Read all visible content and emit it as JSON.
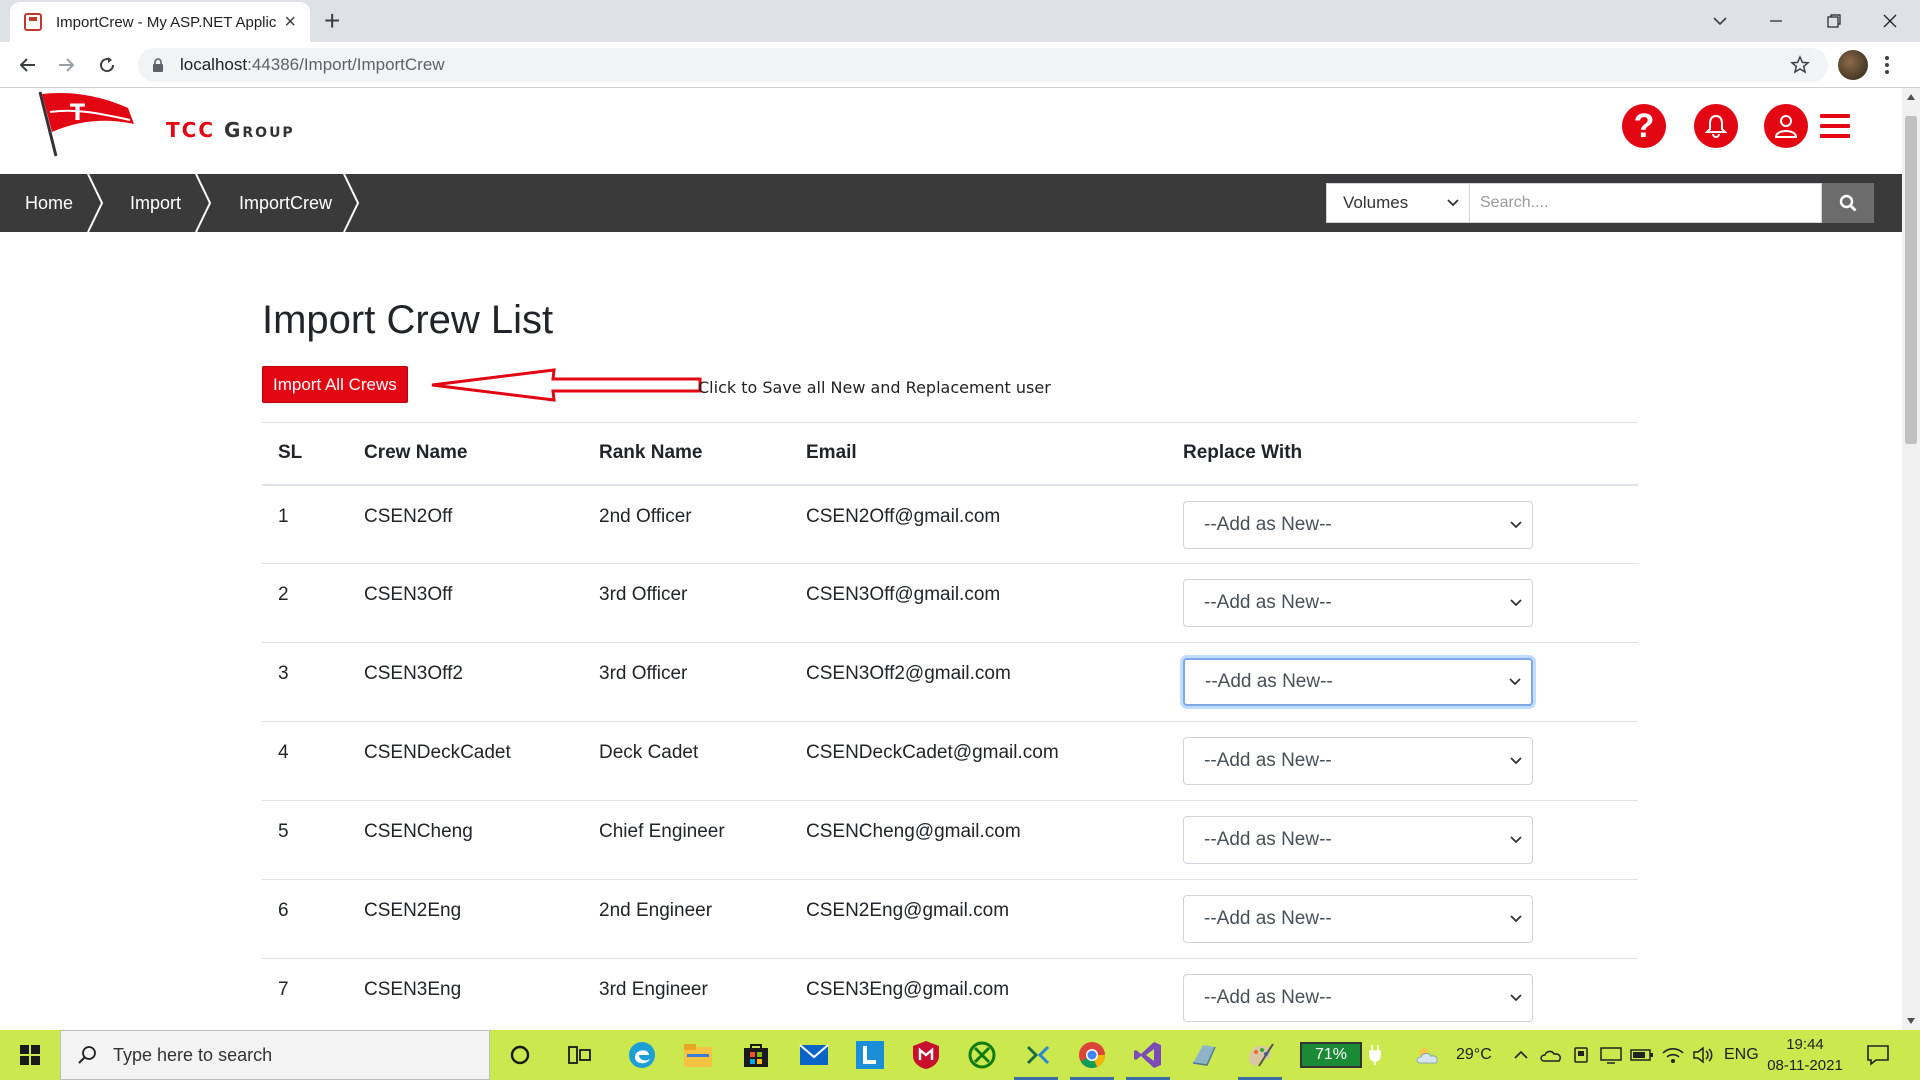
{
  "browser": {
    "tab_title": "ImportCrew - My ASP.NET Applic",
    "url_host": "localhost",
    "url_rest": ":44386/Import/ImportCrew"
  },
  "header": {
    "logo_tcc": "TCC",
    "logo_group": "Group",
    "logo_flag_letter": "T",
    "help_icon": "question-icon",
    "notif_icon": "bell-icon",
    "user_icon": "user-icon",
    "menu_icon": "hamburger-icon",
    "accent": "#e30613"
  },
  "breadcrumb": [
    "Home",
    "Import",
    "ImportCrew"
  ],
  "search": {
    "volume_selected": "Volumes",
    "placeholder": "Search...."
  },
  "main": {
    "title": "Import Crew List",
    "import_button": "Import All Crews",
    "note": "Click to Save all New and Replacement user"
  },
  "table": {
    "headers": [
      "SL",
      "Crew Name",
      "Rank Name",
      "Email",
      "Replace With"
    ],
    "rows": [
      {
        "sl": "1",
        "name": "CSEN2Off",
        "rank": "2nd Officer",
        "email": "CSEN2Off@gmail.com",
        "replace": "--Add as New--"
      },
      {
        "sl": "2",
        "name": "CSEN3Off",
        "rank": "3rd Officer",
        "email": "CSEN3Off@gmail.com",
        "replace": "--Add as New--"
      },
      {
        "sl": "3",
        "name": "CSEN3Off2",
        "rank": "3rd Officer",
        "email": "CSEN3Off2@gmail.com",
        "replace": "--Add as New--"
      },
      {
        "sl": "4",
        "name": "CSENDeckCadet",
        "rank": "Deck Cadet",
        "email": "CSENDeckCadet@gmail.com",
        "replace": "--Add as New--"
      },
      {
        "sl": "5",
        "name": "CSENCheng",
        "rank": "Chief Engineer",
        "email": "CSENCheng@gmail.com",
        "replace": "--Add as New--"
      },
      {
        "sl": "6",
        "name": "CSEN2Eng",
        "rank": "2nd Engineer",
        "email": "CSEN2Eng@gmail.com",
        "replace": "--Add as New--"
      },
      {
        "sl": "7",
        "name": "CSEN3Eng",
        "rank": "3rd Engineer",
        "email": "CSEN3Eng@gmail.com",
        "replace": "--Add as New--"
      }
    ]
  },
  "taskbar": {
    "search_placeholder": "Type here to search",
    "battery": "71%",
    "temperature": "29°C",
    "language": "ENG",
    "time": "19:44",
    "date": "08-11-2021",
    "color": "#cbe84f"
  }
}
